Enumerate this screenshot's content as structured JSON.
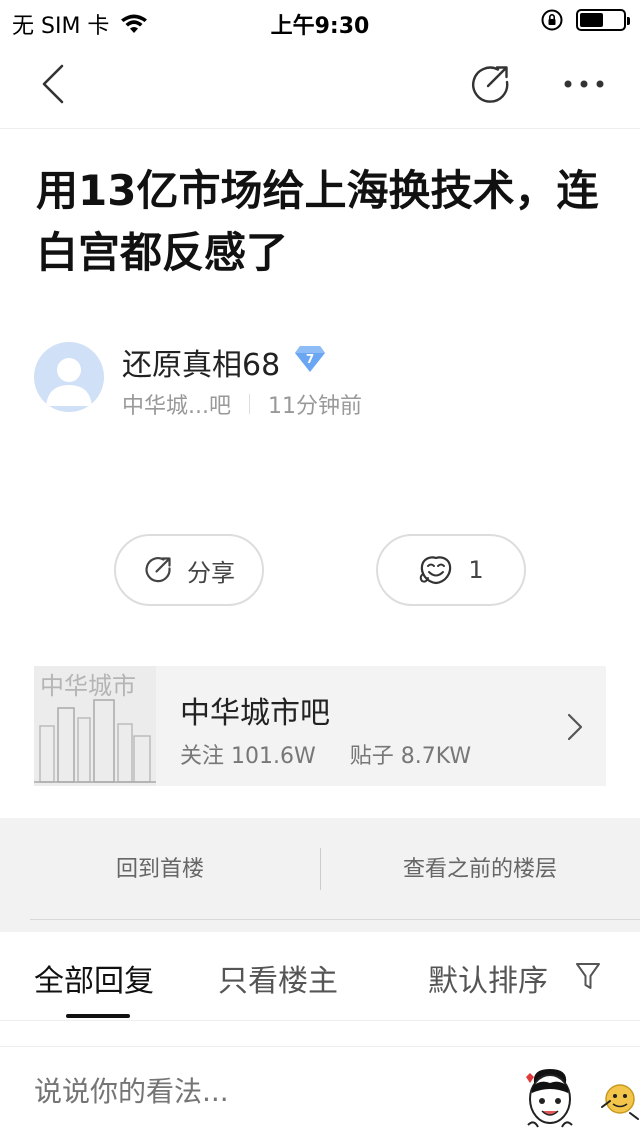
{
  "status_bar": {
    "carrier": "无 SIM 卡",
    "time": "上午9:30",
    "battery_level": 0.55
  },
  "nav": {
    "icons": [
      "chevron-left-icon",
      "share-icon",
      "more-icon"
    ]
  },
  "post": {
    "title": "用13亿市场给上海换技术，连白宫都反感了",
    "author": {
      "name": "还原真相68",
      "level": "7",
      "forum_short": "中华城...吧",
      "time_ago": "11分钟前"
    }
  },
  "actions": {
    "share_label": "分享",
    "like_count": "1"
  },
  "forum": {
    "name": "中华城市吧",
    "thumb_text": "中华城市",
    "follow_label": "关注",
    "follow_count": "101.6W",
    "posts_label": "贴子",
    "posts_count": "8.7KW"
  },
  "floor_nav": {
    "first": "回到首楼",
    "previous": "查看之前的楼层"
  },
  "tabs": {
    "all": "全部回复",
    "author_only": "只看楼主",
    "sort": "默认排序"
  },
  "comment": {
    "placeholder": "说说你的看法..."
  },
  "colors": {
    "accent": "#4d8ef0",
    "avatar_bg": "#cfe0f7",
    "muted": "#999999"
  }
}
